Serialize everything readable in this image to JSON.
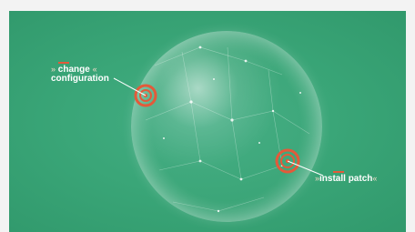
{
  "callouts": [
    {
      "line1": "change",
      "line2": "configuration",
      "open": "»",
      "close": "«"
    },
    {
      "text": "install patch",
      "open": "»",
      "close": "«"
    }
  ],
  "colors": {
    "background": "#3aa678",
    "target_ring": "#e35a3a",
    "accent_dash": "#e35a3a"
  }
}
